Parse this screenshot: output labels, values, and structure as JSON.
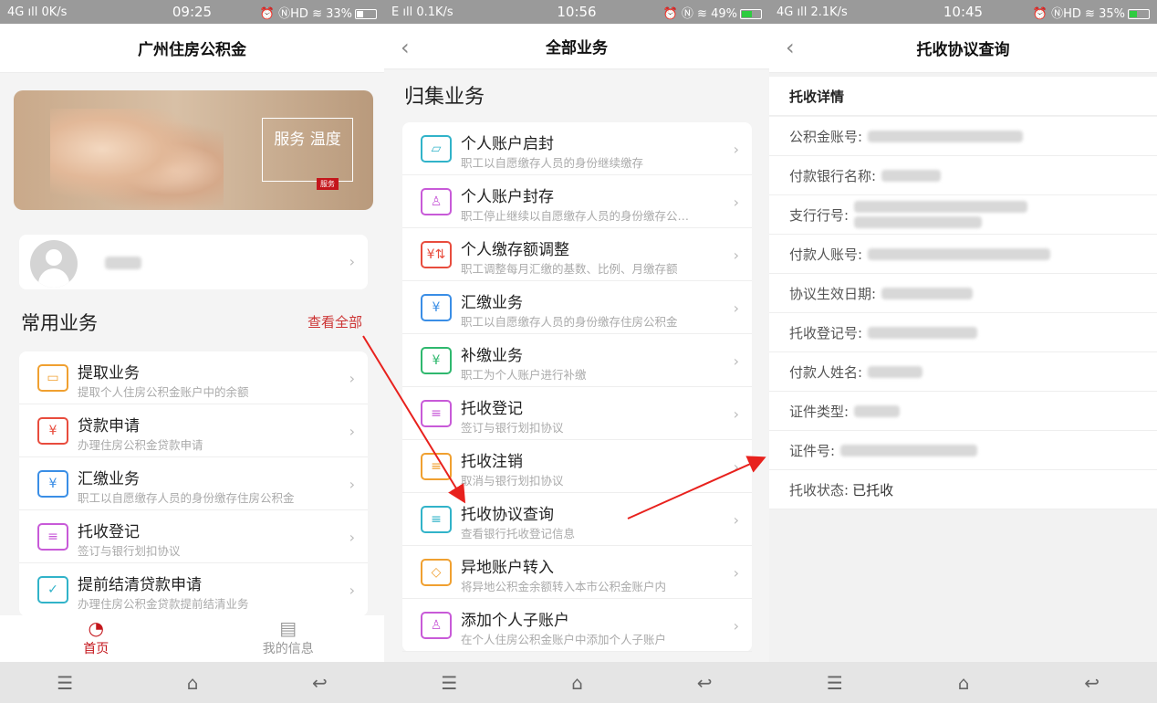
{
  "screen1": {
    "status": {
      "left": "4G ıll 0K/s",
      "time": "09:25",
      "right": "⏰ ⓃHD ≋ 33%"
    },
    "title": "广州住房公积金",
    "banner_slogan": "服务 温度",
    "banner_badge": "服务",
    "common_title": "常用业务",
    "see_all": "查看全部",
    "items": [
      {
        "title": "提取业务",
        "sub": "提取个人住房公积金账户中的余额",
        "icon": "wallet-icon",
        "color": "#f0a030",
        "glyph": "▭"
      },
      {
        "title": "贷款申请",
        "sub": "办理住房公积金贷款申请",
        "icon": "loan-icon",
        "color": "#e84c3d",
        "glyph": "¥"
      },
      {
        "title": "汇缴业务",
        "sub": "职工以自愿缴存人员的身份缴存住房公积金",
        "icon": "yuan-cycle-icon",
        "color": "#3a8ee6",
        "glyph": "¥"
      },
      {
        "title": "托收登记",
        "sub": "签订与银行划扣协议",
        "icon": "form-edit-icon",
        "color": "#c85ad8",
        "glyph": "≡"
      },
      {
        "title": "提前结清贷款申请",
        "sub": "办理住房公积金贷款提前结清业务",
        "icon": "card-check-icon",
        "color": "#31b3c9",
        "glyph": "✓"
      }
    ],
    "tabs": [
      {
        "label": "首页",
        "icon": "home-logo-icon",
        "glyph": "◔"
      },
      {
        "label": "我的信息",
        "icon": "id-card-icon",
        "glyph": "▤"
      }
    ]
  },
  "screen2": {
    "status": {
      "left": "E ıll 0.1K/s",
      "time": "10:56",
      "right": "⏰ Ⓝ ≋ 49%"
    },
    "title": "全部业务",
    "section": "归集业务",
    "items": [
      {
        "title": "个人账户启封",
        "sub": "职工以自愿缴存人员的身份继续缴存",
        "icon": "folder-open-icon",
        "color": "#31b3c9",
        "glyph": "▱"
      },
      {
        "title": "个人账户封存",
        "sub": "职工停止继续以自愿缴存人员的身份缴存公…",
        "icon": "person-lock-icon",
        "color": "#c85ad8",
        "glyph": "♙"
      },
      {
        "title": "个人缴存额调整",
        "sub": "职工调整每月汇缴的基数、比例、月缴存额",
        "icon": "amount-adjust-icon",
        "color": "#e84c3d",
        "glyph": "¥⇅"
      },
      {
        "title": "汇缴业务",
        "sub": "职工以自愿缴存人员的身份缴存住房公积金",
        "icon": "yuan-cycle-icon",
        "color": "#3a8ee6",
        "glyph": "¥"
      },
      {
        "title": "补缴业务",
        "sub": "职工为个人账户进行补缴",
        "icon": "yuan-plus-icon",
        "color": "#2fb86e",
        "glyph": "¥"
      },
      {
        "title": "托收登记",
        "sub": "签订与银行划扣协议",
        "icon": "form-edit-icon",
        "color": "#c85ad8",
        "glyph": "≡"
      },
      {
        "title": "托收注销",
        "sub": "取消与银行划扣协议",
        "icon": "form-cancel-icon",
        "color": "#f0a030",
        "glyph": "≡"
      },
      {
        "title": "托收协议查询",
        "sub": "查看银行托收登记信息",
        "icon": "form-search-icon",
        "color": "#31b3c9",
        "glyph": "≡"
      },
      {
        "title": "异地账户转入",
        "sub": "将异地公积金余额转入本市公积金账户内",
        "icon": "transfer-icon",
        "color": "#f0a030",
        "glyph": "◇"
      },
      {
        "title": "添加个人子账户",
        "sub": "在个人住房公积金账户中添加个人子账户",
        "icon": "person-add-icon",
        "color": "#c85ad8",
        "glyph": "♙"
      }
    ]
  },
  "screen3": {
    "status": {
      "left": "4G ıll 2.1K/s",
      "time": "10:45",
      "right": "⏰ ⓃHD ≋ 35%"
    },
    "title": "托收协议查询",
    "section": "托收详情",
    "fields": [
      {
        "label": "公积金账号:",
        "value": ""
      },
      {
        "label": "付款银行名称:",
        "value": ""
      },
      {
        "label": "支行行号:",
        "value": ""
      },
      {
        "label": "付款人账号:",
        "value": ""
      },
      {
        "label": "协议生效日期:",
        "value": ""
      },
      {
        "label": "托收登记号:",
        "value": ""
      },
      {
        "label": "付款人姓名:",
        "value": ""
      },
      {
        "label": "证件类型:",
        "value": ""
      },
      {
        "label": "证件号:",
        "value": ""
      },
      {
        "label": "托收状态:",
        "value": "已托收"
      }
    ]
  },
  "colors": {
    "accent": "#c4161c",
    "arrow": "#e8211d"
  }
}
